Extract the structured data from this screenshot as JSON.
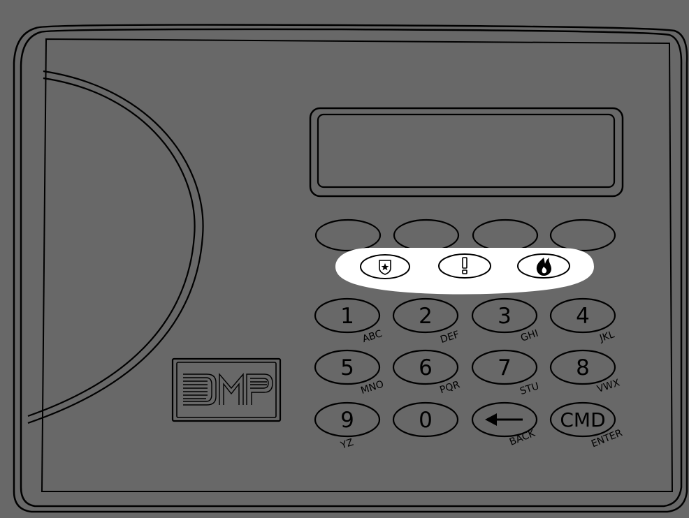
{
  "device": {
    "brand": "DMP",
    "display_text": "",
    "colors": {
      "body": "#686868",
      "outline": "#000000",
      "highlight": "#ffffff"
    }
  },
  "top_buttons": [
    "",
    "",
    "",
    ""
  ],
  "emergency_keys": [
    {
      "icon": "police-shield-icon"
    },
    {
      "icon": "panic-exclamation-icon"
    },
    {
      "icon": "fire-flame-icon"
    }
  ],
  "keys": {
    "k1": {
      "label": "1",
      "sub": "ABC"
    },
    "k2": {
      "label": "2",
      "sub": "DEF"
    },
    "k3": {
      "label": "3",
      "sub": "GHI"
    },
    "k4": {
      "label": "4",
      "sub": "JKL"
    },
    "k5": {
      "label": "5",
      "sub": "MNO"
    },
    "k6": {
      "label": "6",
      "sub": "PQR"
    },
    "k7": {
      "label": "7",
      "sub": "STU"
    },
    "k8": {
      "label": "8",
      "sub": "VWX"
    },
    "k9": {
      "label": "9",
      "sub": "YZ"
    },
    "k0": {
      "label": "0",
      "sub": ""
    },
    "back": {
      "icon": "left-arrow-icon",
      "sub": "BACK"
    },
    "cmd": {
      "label": "CMD",
      "sub": "ENTER"
    }
  }
}
